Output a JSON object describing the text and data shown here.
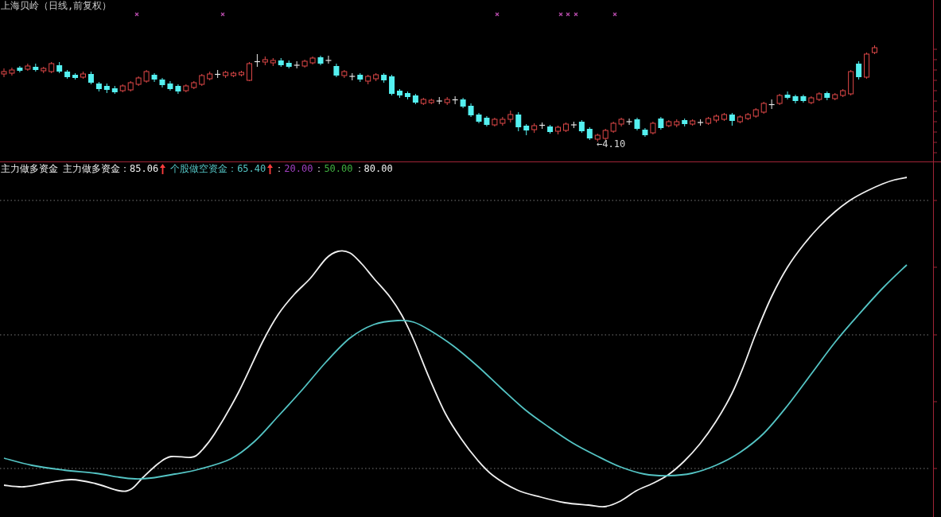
{
  "chart_title": "上海贝岭（日线,前复权）",
  "price_chart": {
    "low_label": "←4.10"
  },
  "indicator": {
    "name": "主力做多资金",
    "series": [
      {
        "label": "主力做多资金：",
        "value": "85.06",
        "rising": true,
        "color": "#f0f0f0"
      },
      {
        "label": "个股做空资金：",
        "value": "65.40",
        "rising": true,
        "color": "#54c4c4"
      }
    ],
    "levels": [
      {
        "separator": "：",
        "value": "20.00",
        "color": "#a040c0"
      },
      {
        "separator": "：",
        "value": "50.00",
        "color": "#40b040"
      },
      {
        "separator": "：",
        "value": "80.00",
        "color": "#f0f0f0"
      }
    ]
  }
}
